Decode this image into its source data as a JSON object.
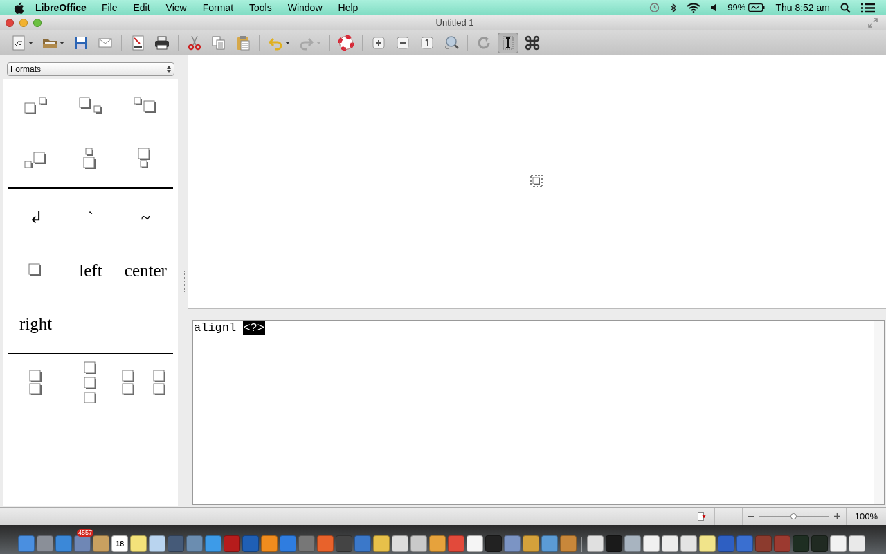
{
  "menubar": {
    "app": "LibreOffice",
    "menus": [
      "File",
      "Edit",
      "View",
      "Format",
      "Tools",
      "Window",
      "Help"
    ],
    "battery": "99%",
    "clock": "Thu 8:52 am"
  },
  "window": {
    "title": "Untitled 1"
  },
  "toolbar": [
    {
      "kind": "new-formula",
      "dropdown": true,
      "disabled": false,
      "pressed": false
    },
    {
      "kind": "open",
      "dropdown": true,
      "disabled": false,
      "pressed": false
    },
    {
      "kind": "save",
      "dropdown": false,
      "disabled": false,
      "pressed": false
    },
    {
      "kind": "mail",
      "dropdown": false,
      "disabled": false,
      "pressed": false
    },
    {
      "kind": "sep"
    },
    {
      "kind": "pdf",
      "dropdown": false,
      "disabled": false,
      "pressed": false
    },
    {
      "kind": "print",
      "dropdown": false,
      "disabled": false,
      "pressed": false
    },
    {
      "kind": "sep"
    },
    {
      "kind": "cut",
      "dropdown": false,
      "disabled": false,
      "pressed": false
    },
    {
      "kind": "copy",
      "dropdown": false,
      "disabled": false,
      "pressed": false
    },
    {
      "kind": "paste",
      "dropdown": false,
      "disabled": false,
      "pressed": false
    },
    {
      "kind": "sep"
    },
    {
      "kind": "undo",
      "dropdown": true,
      "disabled": false,
      "pressed": false
    },
    {
      "kind": "redo",
      "dropdown": true,
      "disabled": true,
      "pressed": false
    },
    {
      "kind": "sep"
    },
    {
      "kind": "help",
      "dropdown": false,
      "disabled": false,
      "pressed": false
    },
    {
      "kind": "sep"
    },
    {
      "kind": "zoom-in",
      "dropdown": false,
      "disabled": false,
      "pressed": false
    },
    {
      "kind": "zoom-out",
      "dropdown": false,
      "disabled": false,
      "pressed": false
    },
    {
      "kind": "zoom-100",
      "dropdown": false,
      "disabled": false,
      "pressed": false
    },
    {
      "kind": "zoom-fit",
      "dropdown": false,
      "disabled": false,
      "pressed": false
    },
    {
      "kind": "sep"
    },
    {
      "kind": "update",
      "dropdown": false,
      "disabled": false,
      "pressed": false
    },
    {
      "kind": "cursor",
      "dropdown": false,
      "disabled": false,
      "pressed": true
    },
    {
      "kind": "symbols",
      "dropdown": false,
      "disabled": false,
      "pressed": false
    }
  ],
  "sidebar": {
    "dropdown": "Formats",
    "sections": [
      [
        {
          "kind": "sup-right"
        },
        {
          "kind": "sub-right"
        },
        {
          "kind": "sup-left"
        },
        {
          "kind": "sub-left"
        },
        {
          "kind": "over"
        },
        {
          "kind": "under"
        }
      ],
      [
        {
          "kind": "text",
          "label": "↲"
        },
        {
          "kind": "text",
          "label": "`"
        },
        {
          "kind": "text",
          "label": "~"
        },
        {
          "kind": "box"
        },
        {
          "kind": "word",
          "label": "left"
        },
        {
          "kind": "word",
          "label": "center"
        },
        {
          "kind": "word",
          "label": "right"
        }
      ],
      [
        {
          "kind": "binom"
        },
        {
          "kind": "stack"
        },
        {
          "kind": "matrix"
        }
      ]
    ]
  },
  "editor": {
    "command": "alignl",
    "placeholder_token": "<?>"
  },
  "status_bar": {
    "zoom_slider": {
      "level": 0.5
    },
    "zoom": "100%"
  },
  "dock": [
    {
      "color": "#4a8fe0"
    },
    {
      "color": "#8a8f98"
    },
    {
      "color": "#3b88d8"
    },
    {
      "color": "#6f87b5",
      "badge": "4557"
    },
    {
      "color": "#c9a060"
    },
    {
      "color": "#ffffff",
      "label": "18"
    },
    {
      "color": "#f3e27a"
    },
    {
      "color": "#b9d4ef"
    },
    {
      "color": "#455a78"
    },
    {
      "color": "#6b8db0"
    },
    {
      "color": "#3d9be8"
    },
    {
      "color": "#b61c1c"
    },
    {
      "color": "#1f5fb5"
    },
    {
      "color": "#f08c1e"
    },
    {
      "color": "#2f7de0"
    },
    {
      "color": "#777777"
    },
    {
      "color": "#e8622b"
    },
    {
      "color": "#444444"
    },
    {
      "color": "#3b78c9"
    },
    {
      "color": "#e7c04a"
    },
    {
      "color": "#dddddd"
    },
    {
      "color": "#c9c9c9"
    },
    {
      "color": "#e6a23c"
    },
    {
      "color": "#e24a3b"
    },
    {
      "color": "#f5f5f5"
    },
    {
      "color": "#222222"
    },
    {
      "color": "#7b94c4"
    },
    {
      "color": "#d4a13b"
    },
    {
      "color": "#5b9bd5"
    },
    {
      "color": "#c8873a"
    },
    {
      "color": "#e0e0e0"
    },
    {
      "color": "#1a1a1a"
    },
    {
      "color": "#a8b4c0"
    },
    {
      "color": "#f0f0f0"
    },
    {
      "color": "#ececec"
    },
    {
      "color": "#e3e3e3"
    },
    {
      "color": "#f1e48a"
    },
    {
      "color": "#2e5fc2"
    },
    {
      "color": "#3a6fd0"
    },
    {
      "color": "#8c3b2e"
    },
    {
      "color": "#9c3a30"
    },
    {
      "color": "#1e2e22"
    },
    {
      "color": "#202a22"
    },
    {
      "color": "#f2f2f2"
    },
    {
      "color": "#e9e9e9"
    }
  ]
}
